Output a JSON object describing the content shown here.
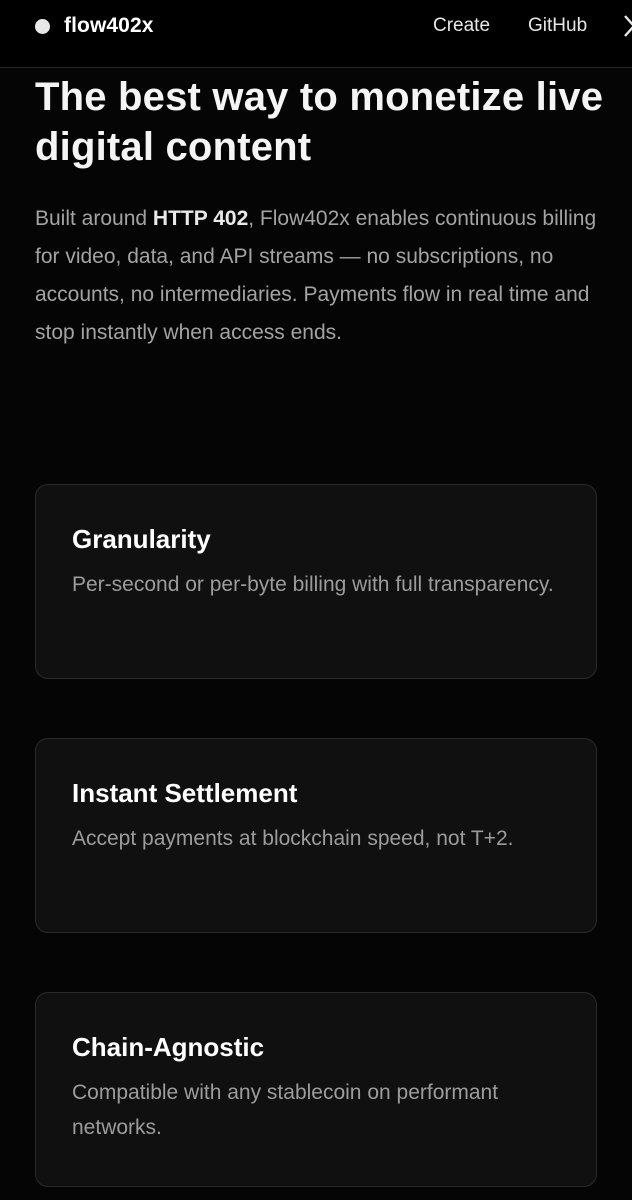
{
  "header": {
    "brand": "flow402x",
    "nav": {
      "create": "Create",
      "github": "GitHub"
    },
    "social_icon": "x-icon"
  },
  "hero": {
    "title": "The best way to monetize live digital content",
    "desc_before": "Built around ",
    "desc_bold": "HTTP 402",
    "desc_after": ", Flow402x enables continuous billing for video, data, and API streams — no subscriptions, no accounts, no intermediaries. Payments flow in real time and stop instantly when access ends."
  },
  "features": [
    {
      "title": "Granularity",
      "description": "Per-second or per-byte billing with full transparency."
    },
    {
      "title": "Instant Settlement",
      "description": "Accept payments at blockchain speed, not T+2."
    },
    {
      "title": "Chain-Agnostic",
      "description": "Compatible with any stablecoin on performant networks."
    }
  ],
  "colors": {
    "background": "#050505",
    "card_background": "#101010",
    "card_border": "#2a2a2a",
    "muted_text": "#a3a3a3"
  }
}
